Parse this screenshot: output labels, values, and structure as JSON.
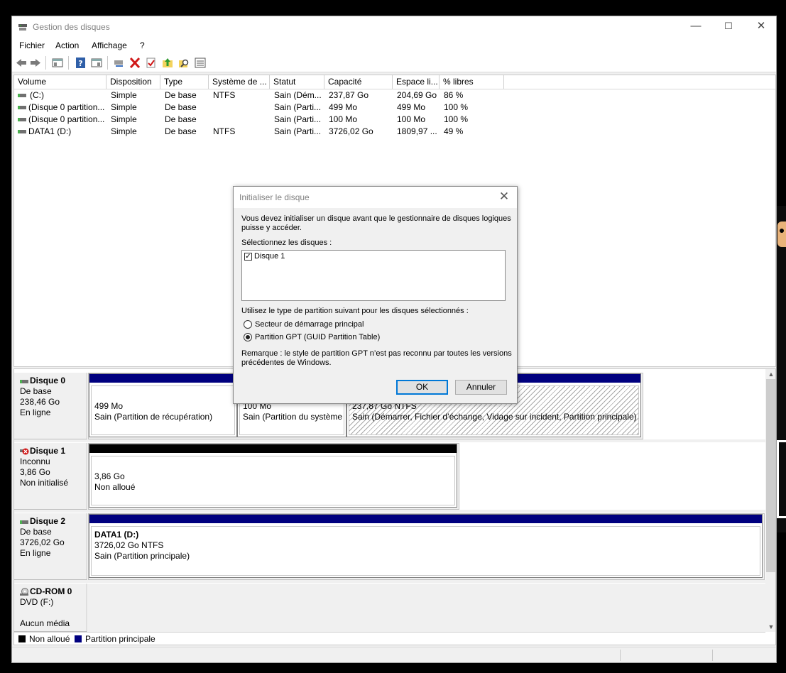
{
  "window": {
    "title": "Gestion des disques",
    "minimize": "—",
    "maximize": "☐",
    "close": "✕"
  },
  "menu": [
    "Fichier",
    "Action",
    "Affichage",
    "?"
  ],
  "toolbar_icons": [
    "back-arrow",
    "forward-arrow",
    "properties",
    "help",
    "console-tree",
    "connect",
    "delete",
    "check",
    "up",
    "search",
    "details"
  ],
  "volumes": {
    "columns": [
      "Volume",
      "Disposition",
      "Type",
      "Système de ...",
      "Statut",
      "Capacité",
      "Espace li...",
      "% libres"
    ],
    "rows": [
      [
        "(C:)",
        "Simple",
        "De base",
        "NTFS",
        "Sain (Dém...",
        "237,87 Go",
        "204,69 Go",
        "86 %"
      ],
      [
        "(Disque 0 partition...",
        "Simple",
        "De base",
        "",
        "Sain (Parti...",
        "499 Mo",
        "499 Mo",
        "100 %"
      ],
      [
        "(Disque 0 partition...",
        "Simple",
        "De base",
        "",
        "Sain (Parti...",
        "100 Mo",
        "100 Mo",
        "100 %"
      ],
      [
        "DATA1 (D:)",
        "Simple",
        "De base",
        "NTFS",
        "Sain (Parti...",
        "3726,02 Go",
        "1809,97 ...",
        "49 %"
      ]
    ]
  },
  "dialog": {
    "title": "Initialiser le disque",
    "close": "✕",
    "intro_line1": "Vous devez initialiser un disque avant que le gestionnaire de disques logiques",
    "intro_line2": "puisse y accéder.",
    "select_label": "Sélectionnez les disques :",
    "disk_item": "Disque 1",
    "disk_checked": true,
    "partition_label": "Utilisez le type de partition suivant pour les disques sélectionnés :",
    "option_mbr": "Secteur de démarrage principal",
    "option_gpt": "Partition GPT (GUID Partition Table)",
    "selected_option": "gpt",
    "note_line1": "Remarque : le style de partition GPT n’est pas reconnu par toutes les versions",
    "note_line2": "précédentes de Windows.",
    "ok": "OK",
    "cancel": "Annuler"
  },
  "disks": [
    {
      "name": "Disque 0",
      "type": "De base",
      "size": "238,46 Go",
      "state": "En ligne",
      "partitions": [
        {
          "line1": "499 Mo",
          "line2": "Sain (Partition de récupération)"
        },
        {
          "line1": "100 Mo",
          "line2": "Sain (Partition du système"
        },
        {
          "line1": "237,87 Go NTFS",
          "line2": "Sain (Démarrer, Fichier d’échange, Vidage sur incident, Partition principale)"
        }
      ]
    },
    {
      "name": "Disque 1",
      "type": "Inconnu",
      "size": "3,86 Go",
      "state": "Non initialisé",
      "partitions": [
        {
          "line1": "3,86 Go",
          "line2": "Non alloué"
        }
      ]
    },
    {
      "name": "Disque 2",
      "type": "De base",
      "size": "3726,02 Go",
      "state": "En ligne",
      "partitions": [
        {
          "title": "DATA1  (D:)",
          "line1": "3726,02 Go NTFS",
          "line2": "Sain (Partition principale)"
        }
      ]
    },
    {
      "name": "CD-ROM 0",
      "type": "DVD (F:)",
      "state": "Aucun média"
    }
  ],
  "legend": {
    "unallocated": "Non alloué",
    "primary": "Partition principale"
  },
  "colors": {
    "primary_partition": "#00007f",
    "unallocated": "#000000",
    "dialog_bg": "#f0f0f0",
    "focus_blue": "#0078d7"
  }
}
